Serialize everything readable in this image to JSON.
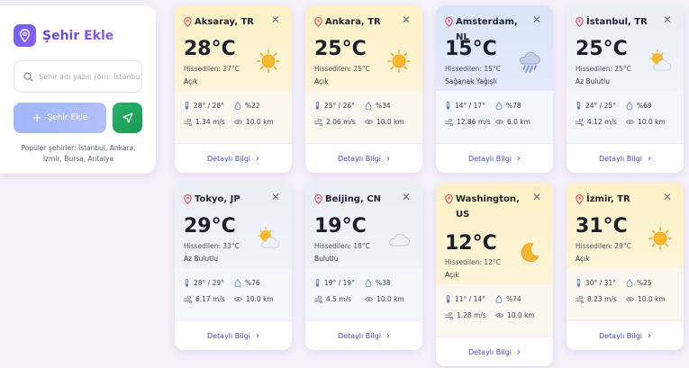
{
  "sidebar": {
    "title": "Şehir Ekle",
    "search_placeholder": "Şehir adı yazın (örn: İstanbul)",
    "add_button": "Şehir Ekle",
    "popular": "Popüler şehirler: İstanbul, Ankara, İzmir, Bursa, Antalya"
  },
  "common": {
    "detail_label": "Detaylı Bilgi"
  },
  "cards": [
    {
      "city": "Aksaray, TR",
      "temp": "28°C",
      "feels": "Hissedilen: 27°C",
      "desc": "Açık",
      "icon": "sun-icon",
      "minmax": "28° / 28°",
      "humidity": "%22",
      "wind": "1.34 m/s",
      "visibility": "10.0 km"
    },
    {
      "city": "Ankara, TR",
      "temp": "25°C",
      "feels": "Hissedilen: 25°C",
      "desc": "Açık",
      "icon": "sun-icon",
      "minmax": "25° / 26°",
      "humidity": "%34",
      "wind": "2.06 m/s",
      "visibility": "10.0 km"
    },
    {
      "city": "Amsterdam, NL",
      "temp": "15°C",
      "feels": "Hissedilen: 15°C",
      "desc": "Sağanak Yağışlı",
      "icon": "rain-cloud-icon",
      "minmax": "14° / 17°",
      "humidity": "%78",
      "wind": "12.86 m/s",
      "visibility": "6.0 km"
    },
    {
      "city": "İstanbul, TR",
      "temp": "25°C",
      "feels": "Hissedilen: 25°C",
      "desc": "Az Bulutlu",
      "icon": "partly-cloudy-icon",
      "minmax": "24° / 25°",
      "humidity": "%69",
      "wind": "4.12 m/s",
      "visibility": "10.0 km"
    },
    {
      "city": "Tokyo, JP",
      "temp": "29°C",
      "feels": "Hissedilen: 33°C",
      "desc": "Az Bulutlu",
      "icon": "partly-cloudy-icon",
      "minmax": "28° / 29°",
      "humidity": "%76",
      "wind": "6.17 m/s",
      "visibility": "10.0 km"
    },
    {
      "city": "Beijing, CN",
      "temp": "19°C",
      "feels": "Hissedilen: 18°C",
      "desc": "Bulutlu",
      "icon": "cloud-icon",
      "minmax": "19° / 19°",
      "humidity": "%38",
      "wind": "4.5 m/s",
      "visibility": "10.0 km"
    },
    {
      "city": "Washington, US",
      "temp": "12°C",
      "feels": "Hissedilen: 12°C",
      "desc": "Açık",
      "icon": "moon-icon",
      "minmax": "11° / 14°",
      "humidity": "%74",
      "wind": "1.28 m/s",
      "visibility": "10.0 km"
    },
    {
      "city": "İzmir, TR",
      "temp": "31°C",
      "feels": "Hissedilen: 29°C",
      "desc": "Açık",
      "icon": "sun-icon",
      "minmax": "30° / 31°",
      "humidity": "%25",
      "wind": "8.23 m/s",
      "visibility": "10.0 km"
    }
  ]
}
